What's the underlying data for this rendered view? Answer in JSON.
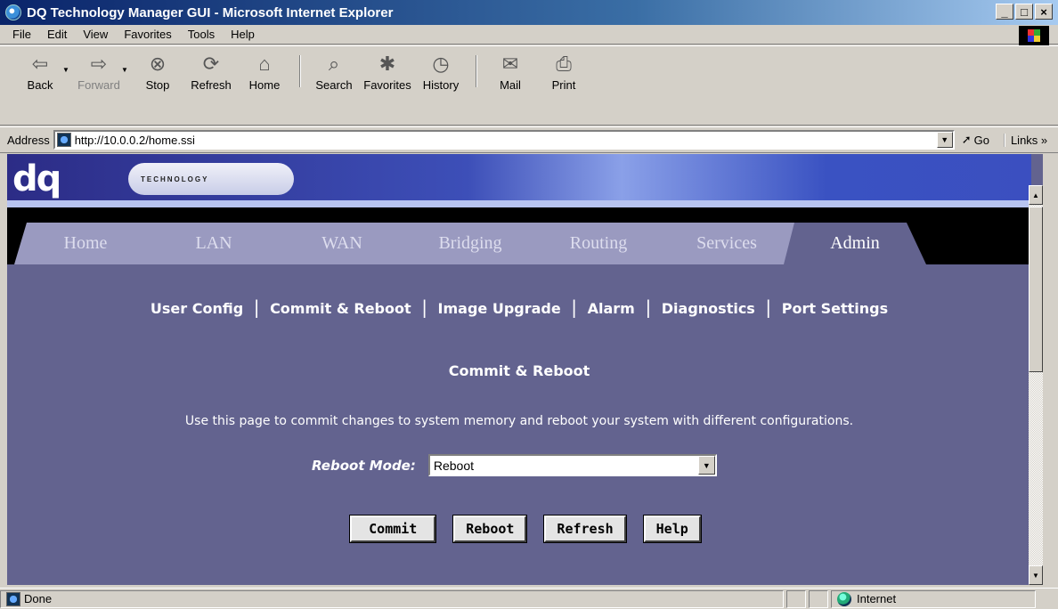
{
  "window": {
    "title": "DQ Technology Manager GUI - Microsoft Internet Explorer",
    "controls": [
      "_",
      "□",
      "×"
    ]
  },
  "menu": [
    "File",
    "Edit",
    "View",
    "Favorites",
    "Tools",
    "Help"
  ],
  "toolbar": {
    "back": "Back",
    "forward": "Forward",
    "stop": "Stop",
    "refresh": "Refresh",
    "home": "Home",
    "search": "Search",
    "favorites": "Favorites",
    "history": "History",
    "mail": "Mail",
    "print": "Print"
  },
  "address": {
    "label": "Address",
    "url": "http://10.0.0.2/home.ssi",
    "go": "Go",
    "links": "Links"
  },
  "branding": {
    "logo_letters": "dq",
    "logo_word": "TECHNOLOGY"
  },
  "tabs": [
    "Home",
    "LAN",
    "WAN",
    "Bridging",
    "Routing",
    "Services",
    "Admin"
  ],
  "active_tab": "Admin",
  "subnav": [
    "User Config",
    "Commit & Reboot",
    "Image Upgrade",
    "Alarm",
    "Diagnostics",
    "Port Settings"
  ],
  "subnav_sep": "|",
  "page": {
    "title": "Commit & Reboot",
    "description": "Use this page to commit changes to system memory and reboot your system with different configurations.",
    "reboot_mode_label": "Reboot Mode:",
    "reboot_mode_value": "Reboot"
  },
  "buttons": {
    "commit": "Commit",
    "reboot": "Reboot",
    "refresh": "Refresh",
    "help": "Help"
  },
  "status": {
    "text": "Done",
    "zone": "Internet"
  },
  "colors": {
    "page_bg": "#63638f",
    "tab_inactive": "#9a9ac0",
    "title_bar": "#0a246a"
  }
}
